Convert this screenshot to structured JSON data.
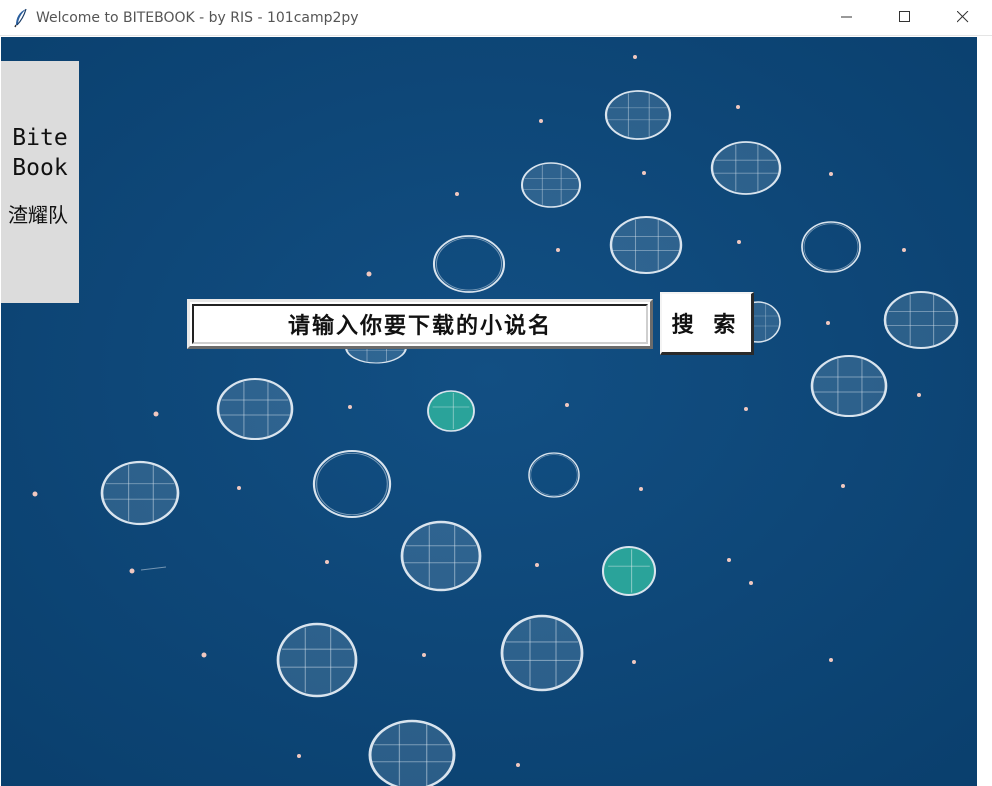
{
  "window": {
    "title": "Welcome to BITEBOOK - by RIS - 101camp2py",
    "app_icon": "feather-icon",
    "controls": [
      "minimize-icon",
      "maximize-icon",
      "close-icon"
    ]
  },
  "sidebar": {
    "brand_line1": "Bite",
    "brand_line2": "Book",
    "team": "渣耀队"
  },
  "search": {
    "placeholder": "请输入你要下载的小说名",
    "button_label": "搜 索"
  },
  "colors": {
    "sea": "#0d4a7c",
    "panel": "#dcdcdc",
    "accent_net": "#2aa39a"
  }
}
